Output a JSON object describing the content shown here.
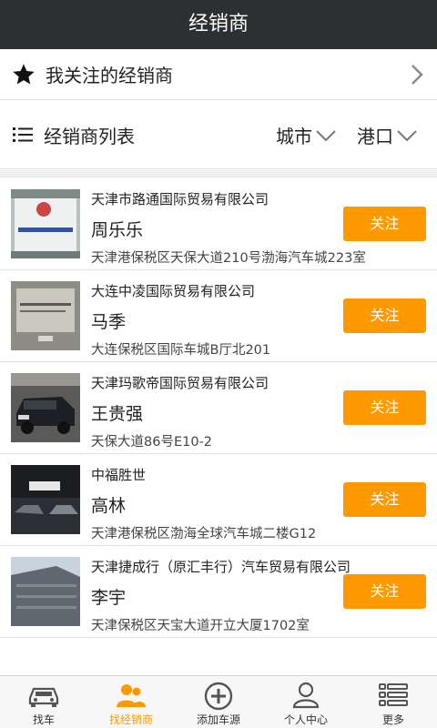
{
  "header": {
    "title": "经销商"
  },
  "favorites": {
    "label": "我关注的经销商"
  },
  "filter": {
    "title": "经销商列表",
    "city_label": "城市",
    "port_label": "港口"
  },
  "dealers": [
    {
      "company": "天津市路通国际贸易有限公司",
      "contact": "周乐乐",
      "address": "天津港保税区天保大道210号渤海汽车城223室",
      "button": "关注"
    },
    {
      "company": "大连中凌国际贸易有限公司",
      "contact": "马季",
      "address": "大连保税区国际车城B厅北201",
      "button": "关注"
    },
    {
      "company": "天津玛歌帝国际贸易有限公司",
      "contact": "王贵强",
      "address": "天保大道86号E10-2",
      "button": "关注"
    },
    {
      "company": "中福胜世",
      "contact": "高林",
      "address": "天津港保税区渤海全球汽车城二楼G12",
      "button": "关注"
    },
    {
      "company": "天津捷成行（原汇丰行）汽车贸易有限公司",
      "contact": "李宇",
      "address": "天津保税区天宝大道开立大厦1702室",
      "button": "关注"
    }
  ],
  "tabs": [
    {
      "label": "找车",
      "icon": "car-icon"
    },
    {
      "label": "找经销商",
      "icon": "dealer-people-icon"
    },
    {
      "label": "添加车源",
      "icon": "add-circle-icon"
    },
    {
      "label": "个人中心",
      "icon": "person-icon"
    },
    {
      "label": "更多",
      "icon": "more-list-icon"
    }
  ],
  "colors": {
    "header_bg": "#2d2f31",
    "accent": "#ff9900",
    "divider": "#e2e2e2"
  }
}
